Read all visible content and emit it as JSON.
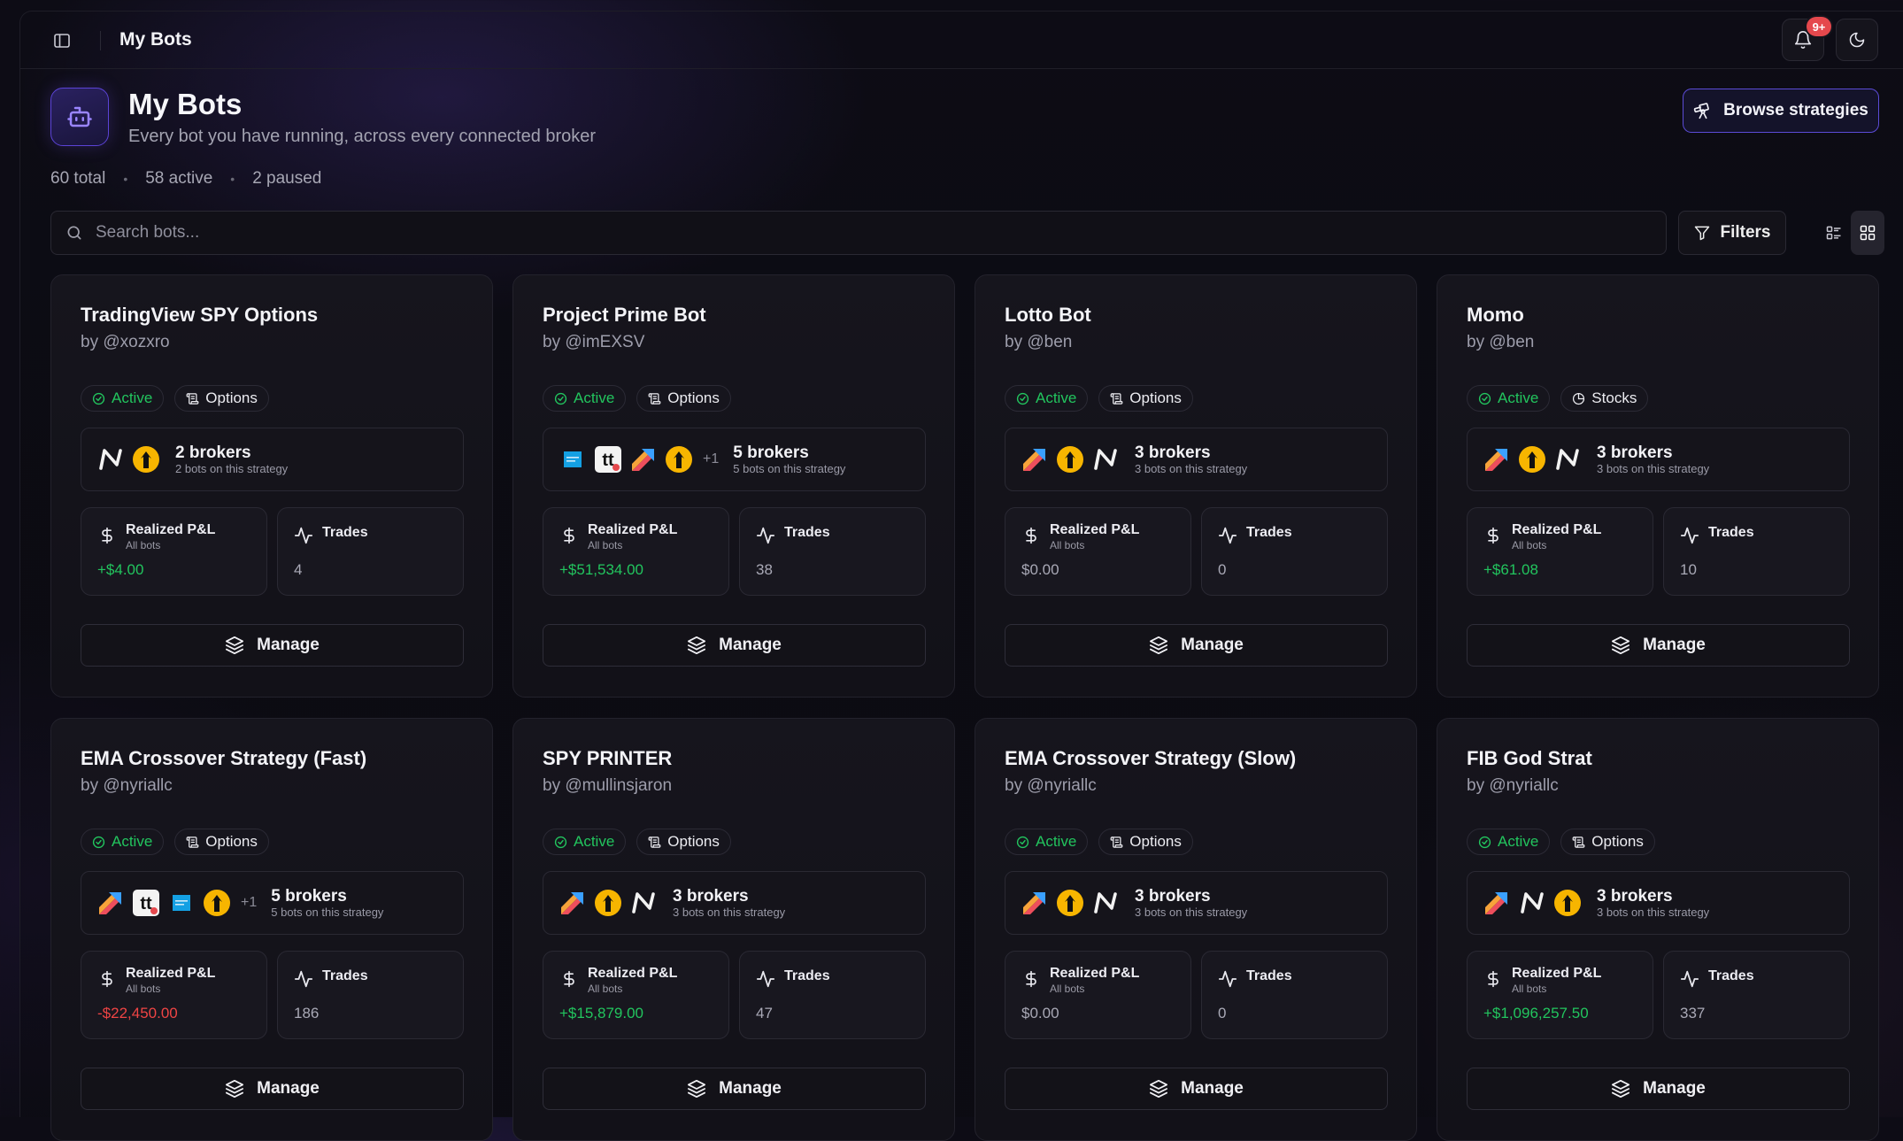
{
  "topbar": {
    "title": "My Bots",
    "notification_badge": "9+"
  },
  "header": {
    "title": "My Bots",
    "subtitle": "Every bot you have running, across every connected broker",
    "browse_label": "Browse strategies"
  },
  "stats": {
    "total": "60 total",
    "active": "58 active",
    "paused": "2 paused"
  },
  "search": {
    "placeholder": "Search bots..."
  },
  "filters_label": "Filters",
  "colors": {
    "accent": "#5b4bd6",
    "positive": "#22c55e",
    "negative": "#ef4444"
  },
  "bots": [
    {
      "name": "TradingView SPY Options",
      "author": "by @xozxro",
      "status": "Active",
      "kind": "Options",
      "kind_icon": "options-icon",
      "brokers": [
        "n-broker",
        "yellow-broker"
      ],
      "extra": "",
      "broker_count": "2 brokers",
      "broker_sub": "2 bots on this strategy",
      "pnl_label": "Realized P&L",
      "pnl_sub": "All bots",
      "pnl": "+$4.00",
      "pnl_sign": "pos",
      "trades_label": "Trades",
      "trades": "4",
      "manage": "Manage"
    },
    {
      "name": "Project Prime Bot",
      "author": "by @imEXSV",
      "status": "Active",
      "kind": "Options",
      "kind_icon": "options-icon",
      "brokers": [
        "schwab-broker",
        "tt-broker",
        "arrow-broker",
        "yellow-broker"
      ],
      "extra": "+1",
      "broker_count": "5 brokers",
      "broker_sub": "5 bots on this strategy",
      "pnl_label": "Realized P&L",
      "pnl_sub": "All bots",
      "pnl": "+$51,534.00",
      "pnl_sign": "pos",
      "trades_label": "Trades",
      "trades": "38",
      "manage": "Manage"
    },
    {
      "name": "Lotto Bot",
      "author": "by @ben",
      "status": "Active",
      "kind": "Options",
      "kind_icon": "options-icon",
      "brokers": [
        "arrow-broker",
        "yellow-broker",
        "n-broker"
      ],
      "extra": "",
      "broker_count": "3 brokers",
      "broker_sub": "3 bots on this strategy",
      "pnl_label": "Realized P&L",
      "pnl_sub": "All bots",
      "pnl": "$0.00",
      "pnl_sign": "zero",
      "trades_label": "Trades",
      "trades": "0",
      "manage": "Manage"
    },
    {
      "name": "Momo",
      "author": "by @ben",
      "status": "Active",
      "kind": "Stocks",
      "kind_icon": "stocks-icon",
      "brokers": [
        "arrow-broker",
        "yellow-broker",
        "n-broker"
      ],
      "extra": "",
      "broker_count": "3 brokers",
      "broker_sub": "3 bots on this strategy",
      "pnl_label": "Realized P&L",
      "pnl_sub": "All bots",
      "pnl": "+$61.08",
      "pnl_sign": "pos",
      "trades_label": "Trades",
      "trades": "10",
      "manage": "Manage"
    },
    {
      "name": "EMA Crossover Strategy (Fast)",
      "author": "by @nyriallc",
      "status": "Active",
      "kind": "Options",
      "kind_icon": "options-icon",
      "brokers": [
        "arrow-broker",
        "tt-broker",
        "schwab-broker",
        "yellow-broker"
      ],
      "extra": "+1",
      "broker_count": "5 brokers",
      "broker_sub": "5 bots on this strategy",
      "pnl_label": "Realized P&L",
      "pnl_sub": "All bots",
      "pnl": "-$22,450.00",
      "pnl_sign": "neg",
      "trades_label": "Trades",
      "trades": "186",
      "manage": "Manage"
    },
    {
      "name": "SPY PRINTER",
      "author": "by @mullinsjaron",
      "status": "Active",
      "kind": "Options",
      "kind_icon": "options-icon",
      "brokers": [
        "arrow-broker",
        "yellow-broker",
        "n-broker"
      ],
      "extra": "",
      "broker_count": "3 brokers",
      "broker_sub": "3 bots on this strategy",
      "pnl_label": "Realized P&L",
      "pnl_sub": "All bots",
      "pnl": "+$15,879.00",
      "pnl_sign": "pos",
      "trades_label": "Trades",
      "trades": "47",
      "manage": "Manage"
    },
    {
      "name": "EMA Crossover Strategy (Slow)",
      "author": "by @nyriallc",
      "status": "Active",
      "kind": "Options",
      "kind_icon": "options-icon",
      "brokers": [
        "arrow-broker",
        "yellow-broker",
        "n-broker"
      ],
      "extra": "",
      "broker_count": "3 brokers",
      "broker_sub": "3 bots on this strategy",
      "pnl_label": "Realized P&L",
      "pnl_sub": "All bots",
      "pnl": "$0.00",
      "pnl_sign": "zero",
      "trades_label": "Trades",
      "trades": "0",
      "manage": "Manage"
    },
    {
      "name": "FIB God Strat",
      "author": "by @nyriallc",
      "status": "Active",
      "kind": "Options",
      "kind_icon": "options-icon",
      "brokers": [
        "arrow-broker",
        "n-broker",
        "yellow-broker"
      ],
      "extra": "",
      "broker_count": "3 brokers",
      "broker_sub": "3 bots on this strategy",
      "pnl_label": "Realized P&L",
      "pnl_sub": "All bots",
      "pnl": "+$1,096,257.50",
      "pnl_sign": "pos",
      "trades_label": "Trades",
      "trades": "337",
      "manage": "Manage"
    }
  ]
}
